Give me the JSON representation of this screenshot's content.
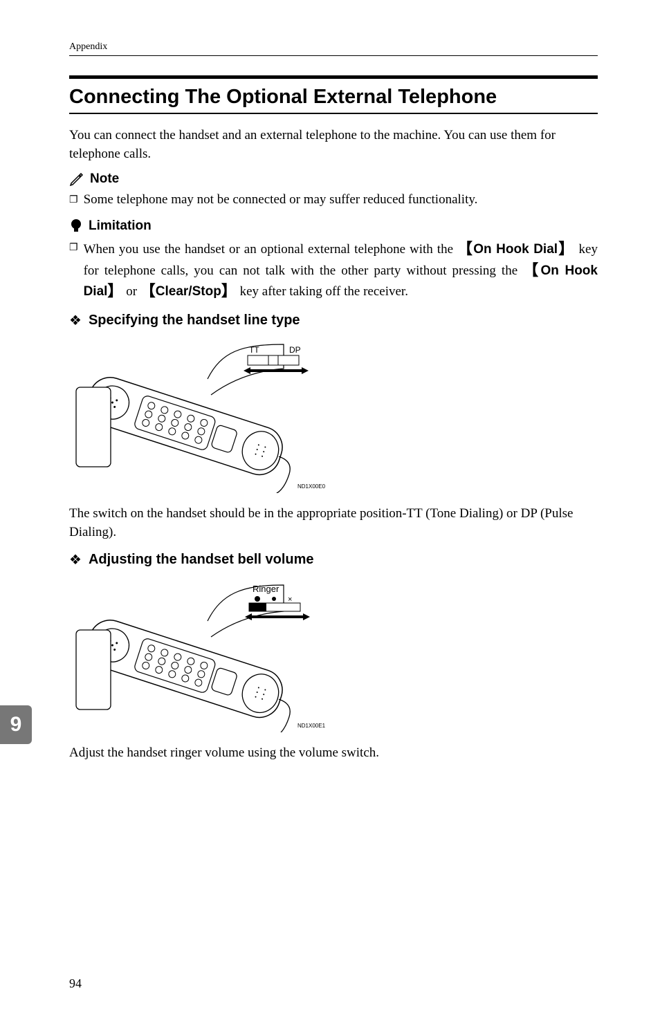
{
  "header": {
    "section": "Appendix"
  },
  "heading": "Connecting The Optional External Telephone",
  "intro": "You can connect the handset and an external telephone to the machine. You can use them for telephone calls.",
  "note": {
    "label": "Note",
    "items": [
      "Some telephone may not be connected or may suffer reduced functionality."
    ]
  },
  "limitation": {
    "label": "Limitation",
    "text_parts": {
      "p1": "When you use the handset or an optional external telephone with the ",
      "key1": "On Hook Dial",
      "p2": " key for telephone calls, you can not talk with the other party without pressing the ",
      "key2": "On Hook Dial",
      "p3": " or ",
      "key3": "Clear/Stop",
      "p4": " key after taking off the receiver."
    }
  },
  "subheadings": {
    "spec": "Specifying the handset line type",
    "adjust": "Adjusting the handset bell volume"
  },
  "illustration_labels": {
    "tt": "TT",
    "dp": "DP",
    "ringer": "Ringer",
    "code1": "ND1X00E0",
    "code2": "ND1X00E1"
  },
  "caption1": "The switch on the handset should be in the appropriate position-TT (Tone Dialing) or DP (Pulse Dialing).",
  "caption2": "Adjust the handset ringer volume using the volume switch.",
  "page_tab": "9",
  "page_number": "94"
}
